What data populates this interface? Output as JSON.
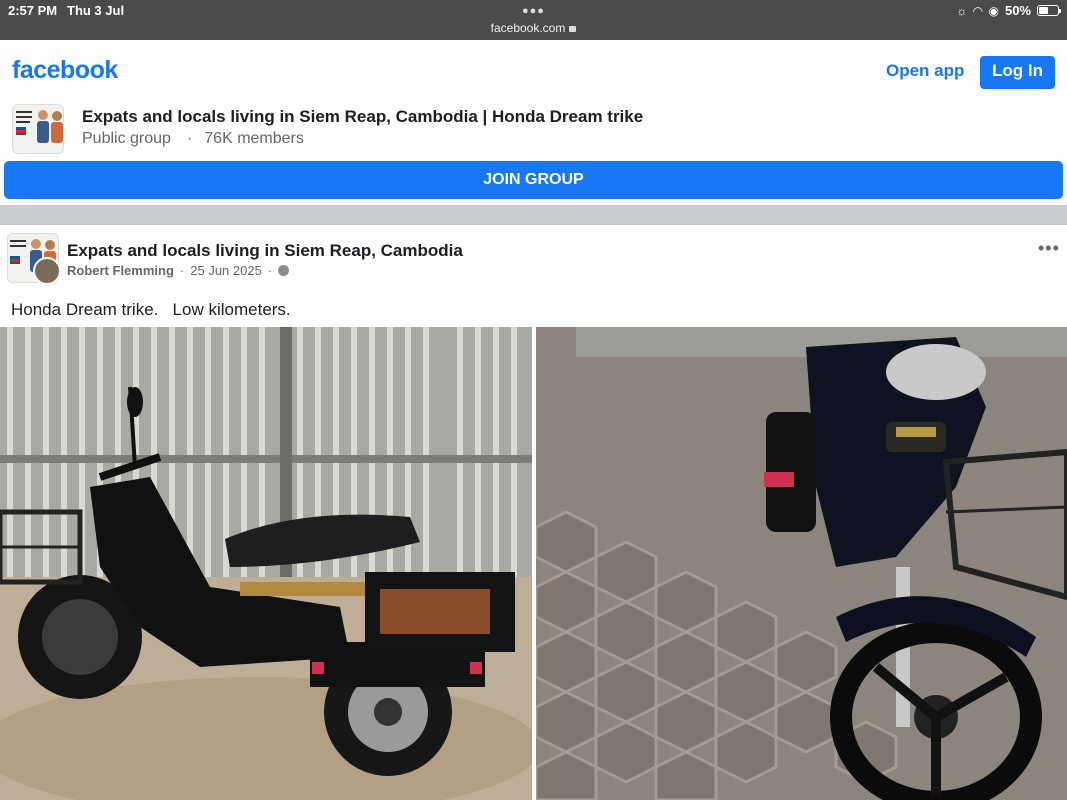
{
  "status_bar": {
    "time": "2:57 PM",
    "date": "Thu 3 Jul",
    "url": "facebook.com",
    "battery": "50%"
  },
  "header": {
    "logo": "facebook",
    "open_app": "Open app",
    "log_in": "Log In"
  },
  "group": {
    "title": "Expats and locals living in Siem Reap, Cambodia | Honda Dream trike",
    "privacy": "Public group",
    "members": "76K members",
    "join_label": "JOIN GROUP"
  },
  "post": {
    "group_name": "Expats and locals living in Siem Reap, Cambodia",
    "author": "Robert Flemming",
    "date": "25 Jun 2025",
    "text": "Honda Dream trike.   Low kilometers.",
    "more_icon": "more-horizontal-icon"
  },
  "colors": {
    "brand": "#1877f2",
    "status_bar": "#4a4a4a",
    "divider": "#c9ccd1"
  }
}
